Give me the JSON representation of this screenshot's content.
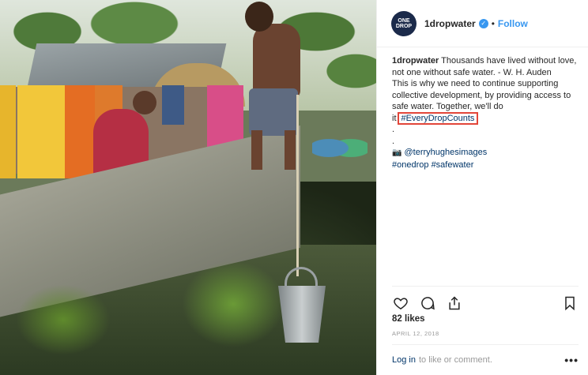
{
  "post": {
    "username": "1dropwater",
    "avatar_text": "ONE DROP",
    "verified_glyph": "✓",
    "separator": "•",
    "follow_label": "Follow",
    "caption": {
      "line1": "Thousands have lived without love, not one without safe water. - W. H. Auden",
      "line2": "This is why we need to continue supporting collective development, by providing access to safe water. Together, we'll do it",
      "hashtag_highlight": "#EveryDropCounts",
      "dot1": ".",
      "dot2": ".",
      "credit_icon": "📷",
      "credit": "@terryhughesimages",
      "tag1": "#onedrop",
      "tag2": "#safewater"
    },
    "likes": "82 likes",
    "date": "APRIL 12, 2018",
    "comment": {
      "login_label": "Log in",
      "rest": "to like or comment.",
      "more_label": "•••"
    },
    "icons": [
      "heart-icon",
      "comment-icon",
      "share-icon",
      "bookmark-icon"
    ],
    "colors": {
      "accent": "#3897f0",
      "link": "#003569",
      "highlight_box": "#e2463a"
    }
  }
}
